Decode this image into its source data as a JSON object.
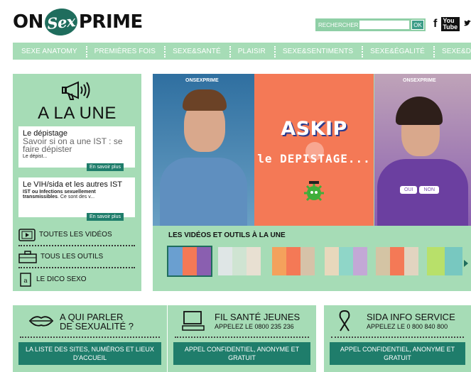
{
  "brand": {
    "logo_left": "ON",
    "logo_mid": "Sex",
    "logo_right": "PRIME"
  },
  "search": {
    "label": "RECHERCHER",
    "placeholder": "",
    "button": "OK"
  },
  "social": {
    "facebook": "f",
    "youtube": "You Tube",
    "twitter": "🐦"
  },
  "nav": {
    "items": [
      "SEXE ANATOMY",
      "PREMIÈRES FOIS",
      "SEXE&SANTÉ",
      "PLAISIR",
      "SEXE&SENTIMENTS",
      "SEXE&ÉGALITÉ",
      "SEXE&DROITS"
    ]
  },
  "une": {
    "title": "A LA UNE",
    "cards": [
      {
        "heading": "Le dépistage",
        "subtitle": "Savoir si on a une IST : se faire dépister",
        "excerpt": "Le dépist...",
        "more": "En savoir plus"
      },
      {
        "heading": "Le VIH/sida et les autres IST",
        "excerpt_bold": "IST ou Infections sexuellement transmissibles",
        "excerpt": ". Ce sont des v...",
        "more": "En savoir plus"
      }
    ],
    "links": [
      "TOUTES LES VIDÉOS",
      "TOUS LES OUTILS",
      "LE DICO SEXO"
    ]
  },
  "video": {
    "askip": "ASKIP",
    "depistage": "le DEPISTAGE...",
    "oui": "OUI",
    "non": "NON",
    "mini_logo": "ONSEXPRIME",
    "section_title": "LES VIDÉOS ET OUTILS À LA UNE"
  },
  "bottom": [
    {
      "title": "A QUI PARLER DE SEXUALITÉ ?",
      "subtitle": "",
      "cta": "LA LISTE DES SITES, NUMÉROS ET LIEUX D'ACCUEIL"
    },
    {
      "title": "FIL SANTÉ JEUNES",
      "subtitle": "APPELEZ LE 0800 235 236",
      "cta": "APPEL CONFIDENTIEL, ANONYME ET GRATUIT"
    },
    {
      "title": "SIDA INFO SERVICE",
      "subtitle": "APPELEZ LE 0 800 840 800",
      "cta": "APPEL CONFIDENTIEL, ANONYME ET GRATUIT"
    }
  ],
  "colors": {
    "panel": "#a6dcb6",
    "dark_green": "#1f7d6b",
    "askip_bg": "#f47956"
  }
}
